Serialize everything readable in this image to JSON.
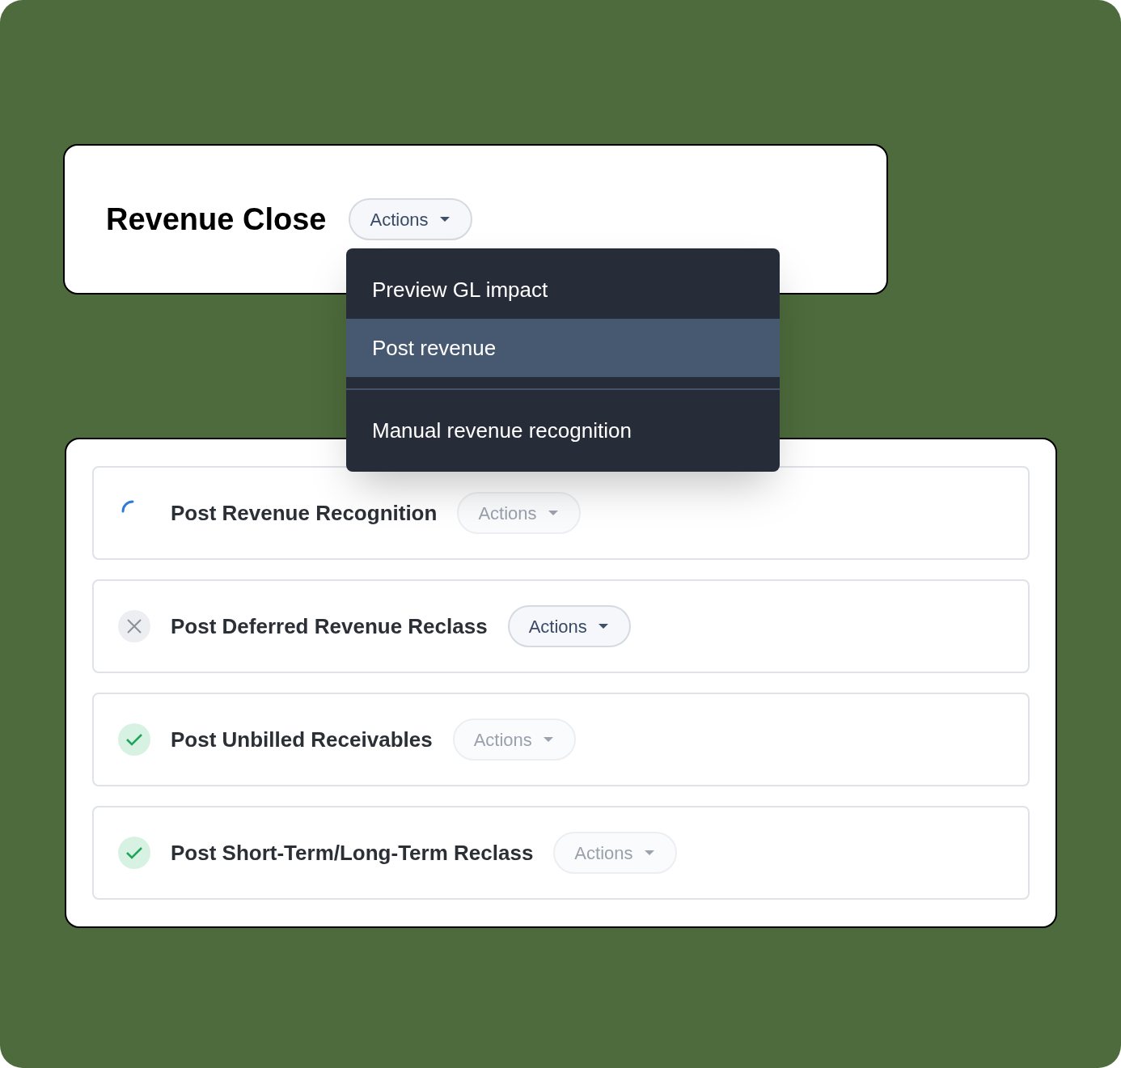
{
  "header": {
    "title": "Revenue Close",
    "actions_button": {
      "label": "Actions",
      "disabled": false
    }
  },
  "actions_menu": {
    "items": [
      {
        "label": "Preview GL impact",
        "selected": false,
        "divider_before": false
      },
      {
        "label": "Post revenue",
        "selected": true,
        "divider_before": false
      },
      {
        "label": "Manual revenue recognition",
        "selected": false,
        "divider_before": true
      }
    ]
  },
  "tasks": [
    {
      "name": "Post Revenue Recognition",
      "kind": "loading",
      "actions_button": {
        "label": "Actions",
        "disabled": true
      }
    },
    {
      "name": "Post Deferred Revenue Reclass",
      "kind": "failed",
      "actions_button": {
        "label": "Actions",
        "disabled": false
      }
    },
    {
      "name": "Post Unbilled Receivables",
      "kind": "done",
      "actions_button": {
        "label": "Actions",
        "disabled": true
      }
    },
    {
      "name": "Post Short-Term/Long-Term Reclass",
      "kind": "done",
      "actions_button": {
        "label": "Actions",
        "disabled": true
      }
    }
  ]
}
